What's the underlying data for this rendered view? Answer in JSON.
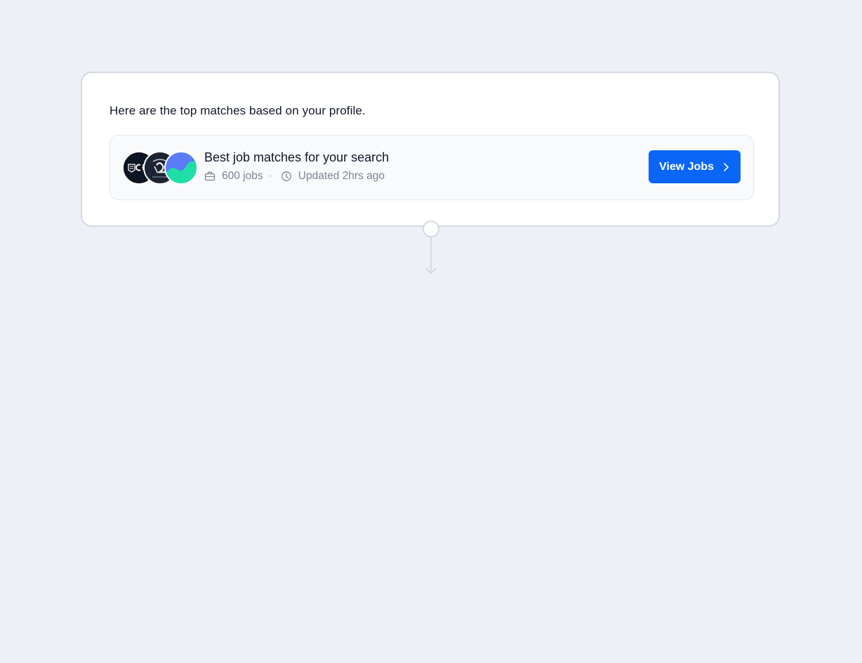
{
  "intro_text": "Here are the top matches based on your profile.",
  "match": {
    "title": "Best job matches for your search",
    "jobs_count": "600 jobs",
    "separator": "·",
    "updated": "Updated 2hrs ago",
    "logos": [
      "company-logo-1",
      "company-logo-2",
      "company-logo-3"
    ],
    "view_button_label": "View Jobs"
  },
  "icons": {
    "briefcase": "briefcase-icon",
    "clock": "clock-icon",
    "chevron": "chevron-right-icon",
    "arrow": "arrow-down-icon"
  },
  "colors": {
    "background": "#edf1f5",
    "card": "#ffffff",
    "accent": "#0a66f6",
    "muted_text": "#7b8494",
    "primary_text": "#101828"
  }
}
